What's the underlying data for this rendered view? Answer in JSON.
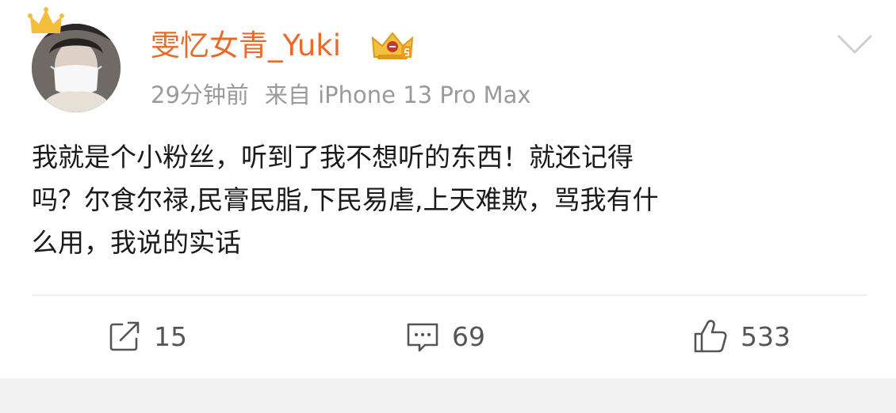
{
  "post": {
    "username": "雯忆女青_Yuki",
    "time": "29分钟前",
    "source": "来自 iPhone 13 Pro Max",
    "content": "我就是个小粉丝，听到了我不想听的东西！就还记得\n吗？尔食尔禄,民膏民脂,下民易虐,上天难欺，骂我有什\n么用，我说的实话",
    "avatar_icon": "user-avatar-photo",
    "badge_icon": "vip-crown-badge-icon",
    "more_icon": "chevron-down-icon"
  },
  "actions": {
    "repost": {
      "icon": "repost-icon",
      "count": "15"
    },
    "comment": {
      "icon": "comment-icon",
      "count": "69"
    },
    "like": {
      "icon": "thumbs-up-icon",
      "count": "533"
    }
  },
  "colors": {
    "username": "#ea6a2a",
    "meta": "#9a9a9a",
    "text": "#1a1a1a",
    "action": "#555555",
    "divider": "#efefef",
    "page_gap": "#f2f2f2",
    "crown": "#f2bf3c"
  }
}
